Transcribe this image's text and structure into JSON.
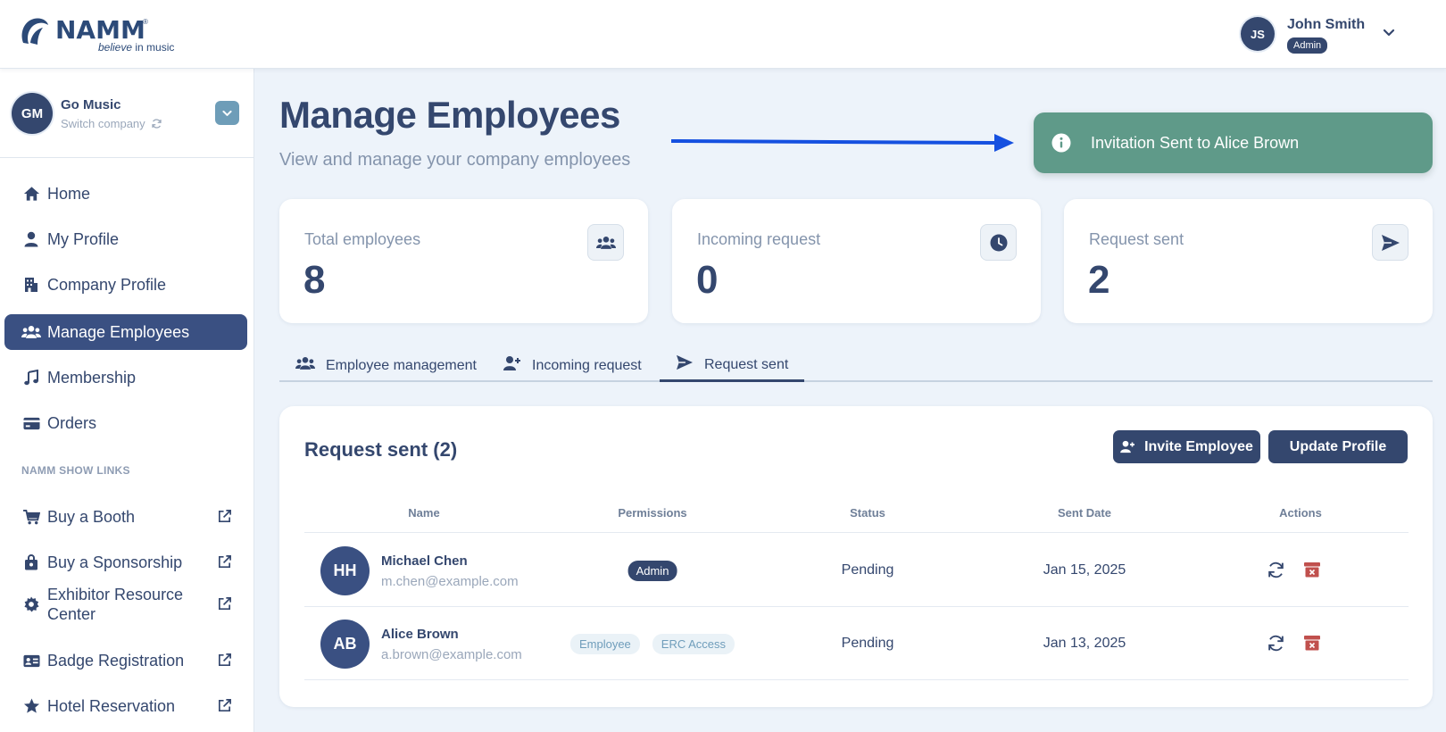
{
  "header": {
    "logo_text": "NAMM",
    "logo_tagline_a": "believe",
    "logo_tagline_b": " in music",
    "user": {
      "initials": "JS",
      "name": "John Smith",
      "role": "Admin"
    }
  },
  "sidebar": {
    "company": {
      "initials": "GM",
      "name": "Go Music",
      "switch_label": "Switch company"
    },
    "items": [
      {
        "label": "Home",
        "icon": "home-icon"
      },
      {
        "label": "My Profile",
        "icon": "user-icon"
      },
      {
        "label": "Company Profile",
        "icon": "building-icon"
      },
      {
        "label": "Manage Employees",
        "icon": "users-icon",
        "active": true
      },
      {
        "label": "Membership",
        "icon": "music-note-icon"
      },
      {
        "label": "Orders",
        "icon": "credit-card-icon"
      }
    ],
    "section_title": "NAMM SHOW LINKS",
    "links": [
      {
        "label": "Buy a Booth",
        "icon": "cart-icon"
      },
      {
        "label": "Buy a Sponsorship",
        "icon": "shopping-bag-icon"
      },
      {
        "label_line1": "Exhibitor Resource",
        "label_line2": "Center",
        "icon": "gear-icon"
      },
      {
        "label": "Badge Registration",
        "icon": "id-badge-icon"
      },
      {
        "label": "Hotel Reservation",
        "icon": "star-icon"
      }
    ]
  },
  "main": {
    "title": "Manage Employees",
    "subtitle": "View and manage your company employees",
    "toast": "Invitation Sent to Alice Brown",
    "stats": [
      {
        "label": "Total employees",
        "value": "8",
        "icon": "users-icon"
      },
      {
        "label": "Incoming request",
        "value": "0",
        "icon": "clock-icon"
      },
      {
        "label": "Request sent",
        "value": "2",
        "icon": "paper-plane-icon"
      }
    ],
    "tabs": [
      {
        "label": "Employee management",
        "icon": "users-icon"
      },
      {
        "label": "Incoming request",
        "icon": "user-plus-icon"
      },
      {
        "label": "Request sent",
        "icon": "paper-plane-icon",
        "active": true
      }
    ],
    "card": {
      "title": "Request sent (2)",
      "invite_label": "Invite Employee",
      "update_label": "Update Profile",
      "columns": [
        "Name",
        "Permissions",
        "Status",
        "Sent Date",
        "Actions"
      ],
      "rows": [
        {
          "initials": "HH",
          "name": "Michael Chen",
          "email": "m.chen@example.com",
          "permissions": [
            "Admin"
          ],
          "status": "Pending",
          "sent_date": "Jan 15, 2025"
        },
        {
          "initials": "AB",
          "name": "Alice Brown",
          "email": "a.brown@example.com",
          "permissions": [
            "Employee",
            "ERC Access"
          ],
          "status": "Pending",
          "sent_date": "Jan 13, 2025"
        }
      ]
    }
  },
  "colors": {
    "primary": "#34476e",
    "toast": "#5f9a89",
    "background": "#edf3fa",
    "danger": "#c0504d",
    "arrow": "#1550e0"
  }
}
